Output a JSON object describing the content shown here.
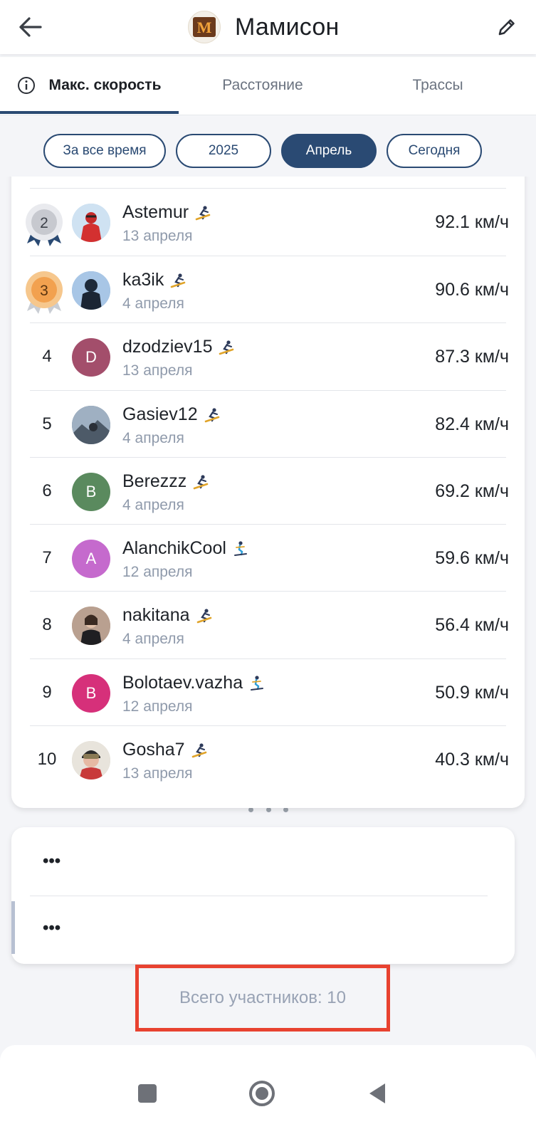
{
  "header": {
    "title": "Мамисон",
    "logo_text": "M"
  },
  "tabs": [
    {
      "label": "Макс. скорость",
      "active": true
    },
    {
      "label": "Расстояние",
      "active": false
    },
    {
      "label": "Трассы",
      "active": false
    }
  ],
  "filters": [
    {
      "label": "За все время",
      "active": false
    },
    {
      "label": "2025",
      "active": false
    },
    {
      "label": "Апрель",
      "active": true
    },
    {
      "label": "Сегодня",
      "active": false
    }
  ],
  "colors": {
    "accent": "#2a4a73",
    "highlight_border": "#e84230"
  },
  "leaderboard": [
    {
      "rank": "2",
      "medal": "silver",
      "name": "Astemur",
      "sport": "snowboard",
      "date": "13 апреля",
      "speed": "92.1 км/ч",
      "avatar": {
        "type": "photo",
        "bg": "#b9d4ea"
      }
    },
    {
      "rank": "3",
      "medal": "bronze",
      "name": "ka3ik",
      "sport": "snowboard",
      "date": "4 апреля",
      "speed": "90.6 км/ч",
      "avatar": {
        "type": "photo",
        "bg": "#8fb3d8"
      }
    },
    {
      "rank": "4",
      "name": "dzodziev15",
      "sport": "snowboard",
      "date": "13 апреля",
      "speed": "87.3 км/ч",
      "avatar": {
        "type": "letter",
        "letter": "D",
        "bg": "#a34e6b"
      }
    },
    {
      "rank": "5",
      "name": "Gasiev12",
      "sport": "snowboard",
      "date": "4 апреля",
      "speed": "82.4 км/ч",
      "avatar": {
        "type": "photo",
        "bg": "#6f7f91"
      }
    },
    {
      "rank": "6",
      "name": "Berezzz",
      "sport": "snowboard",
      "date": "4 апреля",
      "speed": "69.2 км/ч",
      "avatar": {
        "type": "letter",
        "letter": "B",
        "bg": "#5a8a5e"
      }
    },
    {
      "rank": "7",
      "name": "AlanchikCool",
      "sport": "ski",
      "date": "12 апреля",
      "speed": "59.6 км/ч",
      "avatar": {
        "type": "letter",
        "letter": "A",
        "bg": "#c56acd"
      }
    },
    {
      "rank": "8",
      "name": "nakitana",
      "sport": "snowboard",
      "date": "4 апреля",
      "speed": "56.4 км/ч",
      "avatar": {
        "type": "photo",
        "bg": "#c0a898"
      }
    },
    {
      "rank": "9",
      "name": "Bolotaev.vazha",
      "sport": "ski",
      "date": "12 апреля",
      "speed": "50.9 км/ч",
      "avatar": {
        "type": "letter",
        "letter": "B",
        "bg": "#d6307a"
      }
    },
    {
      "rank": "10",
      "name": "Gosha7",
      "sport": "snowboard",
      "date": "13 апреля",
      "speed": "40.3 км/ч",
      "avatar": {
        "type": "photo",
        "bg": "#d8d2c6"
      }
    }
  ],
  "placeholder_rows": [
    "•••",
    "•••"
  ],
  "footer": {
    "total_label": "Всего участников: 10"
  },
  "icons": {
    "back": "arrow-left-icon",
    "edit": "pencil-icon",
    "info": "info-icon",
    "snowboard": "snowboarder-icon",
    "ski": "skier-icon"
  }
}
